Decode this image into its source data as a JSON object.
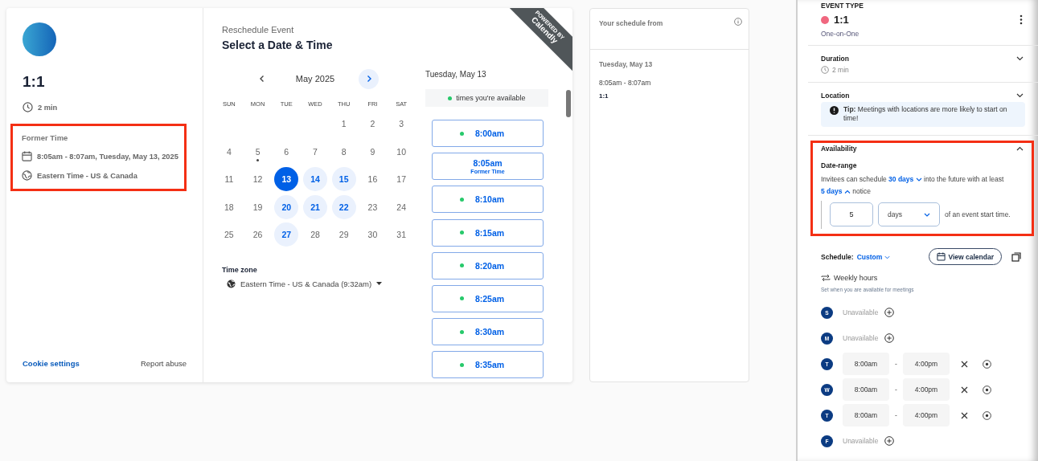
{
  "event": {
    "title": "1:1",
    "duration": "2 min",
    "former_time": {
      "highlighted": true,
      "label": "Former Time",
      "when": "8:05am - 8:07am, Tuesday, May 13, 2025",
      "timezone": "Eastern Time - US & Canada"
    },
    "footer_links": [
      "Cookie settings",
      "Report abuse"
    ]
  },
  "booking": {
    "overline": "Reschedule Event",
    "title": "Select a Date & Time",
    "ribbon": {
      "caption": "POWERED BY",
      "brand": "Calendly"
    },
    "calendar": {
      "month": "May 2025",
      "nav": [
        {
          "disabled": true
        },
        {
          "disabled": false
        }
      ],
      "weekdays": [
        "SUN",
        "MON",
        "TUE",
        "WED",
        "THU",
        "FRI",
        "SAT"
      ],
      "weeks": [
        [
          {
            "label": "1",
            "available": false,
            "selected": false,
            "marked": false
          },
          {
            "label": "2",
            "available": false,
            "selected": false,
            "marked": false
          },
          {
            "label": "3",
            "available": false,
            "selected": false,
            "marked": false
          }
        ],
        [
          {
            "label": "4",
            "available": false,
            "selected": false,
            "marked": false
          },
          {
            "label": "5",
            "available": false,
            "selected": false,
            "marked": true
          },
          {
            "label": "6",
            "available": false,
            "selected": false,
            "marked": false
          },
          {
            "label": "7",
            "available": false,
            "selected": false,
            "marked": false
          },
          {
            "label": "8",
            "available": false,
            "selected": false,
            "marked": false
          },
          {
            "label": "9",
            "available": false,
            "selected": false,
            "marked": false
          },
          {
            "label": "10",
            "available": false,
            "selected": false,
            "marked": false
          }
        ],
        [
          {
            "label": "11",
            "available": false,
            "selected": false,
            "marked": false
          },
          {
            "label": "12",
            "available": false,
            "selected": false,
            "marked": false
          },
          {
            "label": "13",
            "available": true,
            "selected": true,
            "marked": false
          },
          {
            "label": "14",
            "available": true,
            "selected": false,
            "marked": false
          },
          {
            "label": "15",
            "available": true,
            "selected": false,
            "marked": false
          },
          {
            "label": "16",
            "available": false,
            "selected": false,
            "marked": false
          },
          {
            "label": "17",
            "available": false,
            "selected": false,
            "marked": false
          }
        ],
        [
          {
            "label": "18",
            "available": false,
            "selected": false,
            "marked": false
          },
          {
            "label": "19",
            "available": false,
            "selected": false,
            "marked": false
          },
          {
            "label": "20",
            "available": true,
            "selected": false,
            "marked": false
          },
          {
            "label": "21",
            "available": true,
            "selected": false,
            "marked": false
          },
          {
            "label": "22",
            "available": true,
            "selected": false,
            "marked": false
          },
          {
            "label": "23",
            "available": false,
            "selected": false,
            "marked": false
          },
          {
            "label": "24",
            "available": false,
            "selected": false,
            "marked": false
          }
        ],
        [
          {
            "label": "25",
            "available": false,
            "selected": false,
            "marked": false
          },
          {
            "label": "26",
            "available": false,
            "selected": false,
            "marked": false
          },
          {
            "label": "27",
            "available": true,
            "selected": false,
            "marked": false
          },
          {
            "label": "28",
            "available": false,
            "selected": false,
            "marked": false
          },
          {
            "label": "29",
            "available": false,
            "selected": false,
            "marked": false
          },
          {
            "label": "30",
            "available": false,
            "selected": false,
            "marked": false
          },
          {
            "label": "31",
            "available": false,
            "selected": false,
            "marked": false
          }
        ]
      ]
    },
    "timezone": {
      "label": "Time zone",
      "value": "Eastern Time - US & Canada (9:32am)"
    },
    "day_heading": "Tuesday, May 13",
    "legend": "times you're available",
    "slots": [
      {
        "time": "8:00am",
        "available": true
      },
      {
        "time": "8:05am",
        "available": false,
        "note": "Former Time"
      },
      {
        "time": "8:10am",
        "available": true
      },
      {
        "time": "8:15am",
        "available": true
      },
      {
        "time": "8:20am",
        "available": true
      },
      {
        "time": "8:25am",
        "available": true
      },
      {
        "time": "8:30am",
        "available": true
      },
      {
        "time": "8:35am",
        "available": true
      }
    ]
  },
  "schedule_preview": {
    "title": "Your schedule from",
    "date": "Tuesday, May 13",
    "time": "8:05am - 8:07am",
    "event": "1:1"
  },
  "editor": {
    "overline": "EVENT TYPE",
    "title": "1:1",
    "color": "#f0677f",
    "subtitle": "One-on-One",
    "sections": [
      {
        "kind": "duration",
        "title": "Duration",
        "expanded": false,
        "highlighted": false,
        "value": "2 min"
      },
      {
        "kind": "location",
        "title": "Location",
        "expanded": false,
        "highlighted": false,
        "tip": "**Tip:** Meetings with locations are more likely to start on time!"
      },
      {
        "kind": "availability",
        "title": "Availability",
        "expanded": true,
        "highlighted": true,
        "subtitle": "Date-range",
        "prefix": "Invitees can schedule",
        "range": {
          "value": "30 days",
          "expanded": false
        },
        "middle": "into the future with at least",
        "notice": {
          "value": "5 days",
          "expanded": true
        },
        "suffix": "notice",
        "amount": "5",
        "unit": "days",
        "trailing": "of an event start time."
      }
    ],
    "schedule": {
      "label": "Schedule:",
      "value": "Custom",
      "button": "View calendar",
      "weekly_title": "Weekly hours",
      "weekly_hint": "Set when you are available for meetings",
      "days": [
        {
          "letter": "S",
          "kind": "unavailable",
          "text": "Unavailable"
        },
        {
          "letter": "M",
          "kind": "unavailable",
          "text": "Unavailable"
        },
        {
          "letter": "T",
          "kind": "hours",
          "start": "8:00am",
          "separator": "-",
          "end": "4:00pm"
        },
        {
          "letter": "W",
          "kind": "hours",
          "start": "8:00am",
          "separator": "-",
          "end": "4:00pm"
        },
        {
          "letter": "T",
          "kind": "hours",
          "start": "8:00am",
          "separator": "-",
          "end": "4:00pm"
        },
        {
          "letter": "F",
          "kind": "unavailable",
          "text": "Unavailable"
        }
      ]
    }
  }
}
